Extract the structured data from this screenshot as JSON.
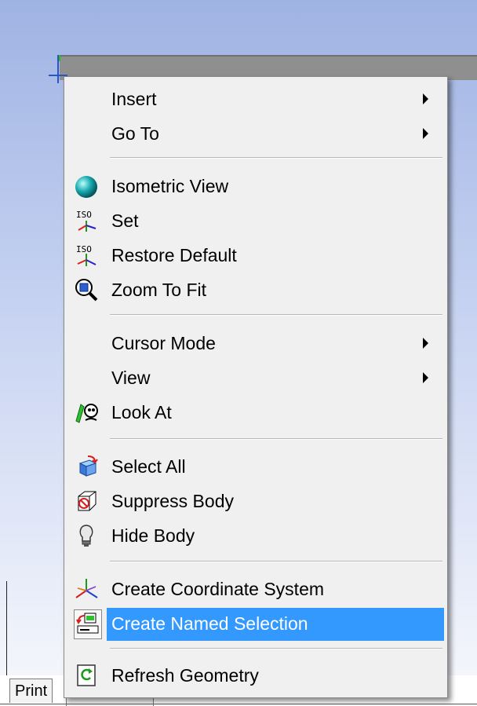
{
  "menu": {
    "items": [
      {
        "label": "Insert",
        "submenu": true
      },
      {
        "label": "Go To",
        "submenu": true
      },
      {
        "label": "Isometric View",
        "icon": "isometric-sphere-icon"
      },
      {
        "label": "Set",
        "icon": "iso-set-icon"
      },
      {
        "label": "Restore Default",
        "icon": "iso-restore-icon"
      },
      {
        "label": "Zoom To Fit",
        "icon": "zoom-fit-icon"
      },
      {
        "label": "Cursor Mode",
        "submenu": true
      },
      {
        "label": "View",
        "submenu": true
      },
      {
        "label": "Look At",
        "icon": "look-at-icon"
      },
      {
        "label": "Select All",
        "icon": "select-all-icon"
      },
      {
        "label": "Suppress Body",
        "icon": "suppress-body-icon"
      },
      {
        "label": "Hide Body",
        "icon": "hide-body-icon"
      },
      {
        "label": "Create Coordinate System",
        "icon": "coordinate-system-icon"
      },
      {
        "label": "Create Named Selection",
        "icon": "named-selection-icon",
        "highlighted": true
      },
      {
        "label": "Refresh Geometry",
        "icon": "refresh-geometry-icon"
      }
    ]
  },
  "tabs": {
    "print_label": "Print"
  },
  "colors": {
    "highlight": "#3399ff",
    "menu_bg": "#f0f0f0",
    "viewport_top": "#9fb3e3"
  }
}
